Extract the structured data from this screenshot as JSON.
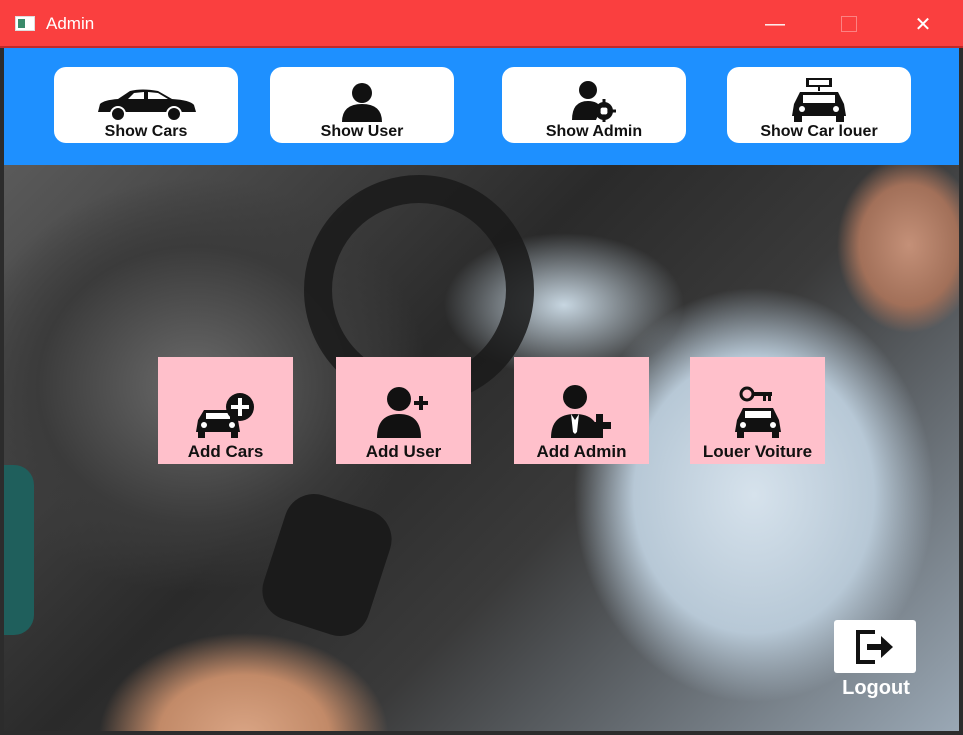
{
  "window": {
    "title": "Admin",
    "controls": {
      "minimize": "—",
      "close": "✕"
    }
  },
  "colors": {
    "titlebar": "#fa3f3f",
    "toolbar": "#1e90ff",
    "tile": "#ffc0cb"
  },
  "toolbar": {
    "buttons": [
      {
        "label": "Show Cars",
        "icon": "car-icon"
      },
      {
        "label": "Show User",
        "icon": "user-icon"
      },
      {
        "label": "Show Admin",
        "icon": "admin-gear-icon"
      },
      {
        "label": "Show Car louer",
        "icon": "rent-car-icon"
      }
    ]
  },
  "actions": {
    "tiles": [
      {
        "label": "Add Cars",
        "icon": "add-car-icon"
      },
      {
        "label": "Add User",
        "icon": "add-user-icon"
      },
      {
        "label": "Add Admin",
        "icon": "add-admin-icon"
      },
      {
        "label": "Louer Voiture",
        "icon": "car-key-icon"
      }
    ]
  },
  "logout": {
    "label": "Logout",
    "icon": "logout-icon"
  }
}
